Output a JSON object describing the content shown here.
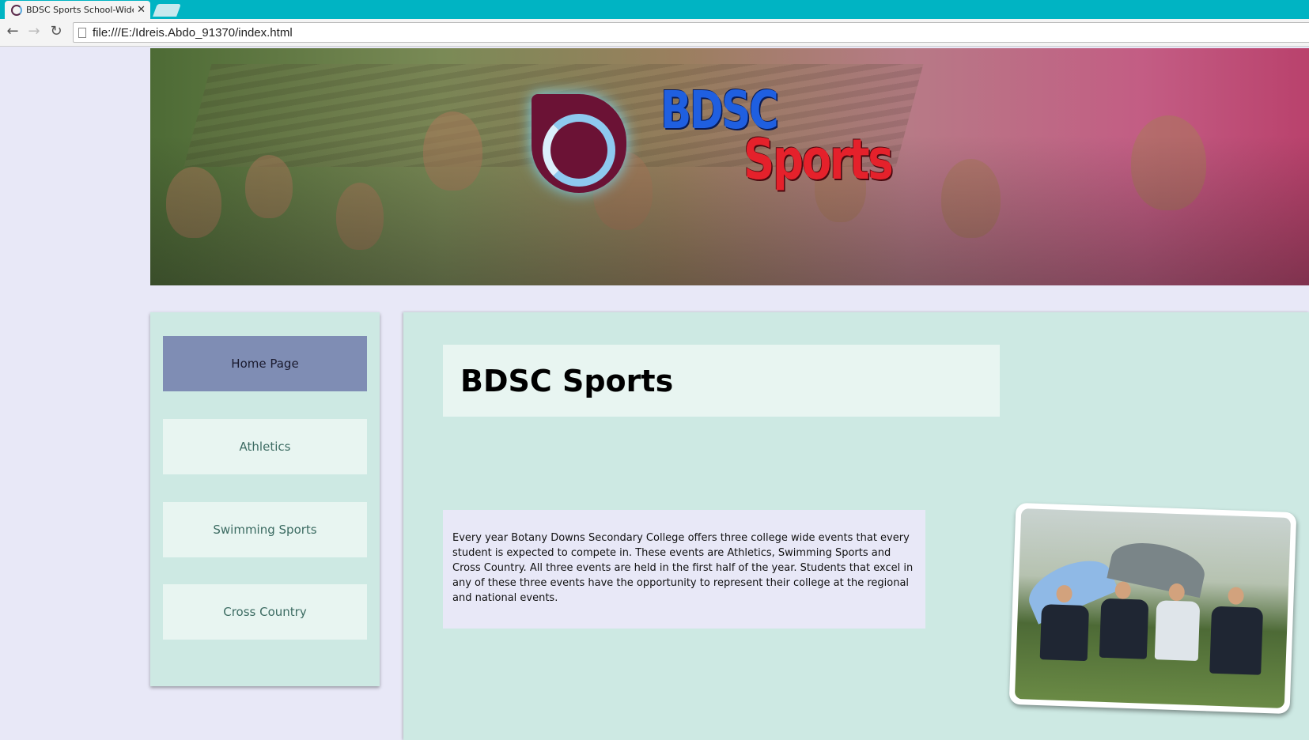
{
  "browser": {
    "tab_title": "BDSC Sports School-Wide",
    "tab_close": "✕",
    "url": "file:///E:/Idreis.Abdo_91370/index.html",
    "back_icon": "←",
    "forward_icon": "→",
    "reload_icon": "↻"
  },
  "banner": {
    "logo_line1": "BDSC",
    "logo_line2": "Sports"
  },
  "sidebar": {
    "items": [
      {
        "label": "Home Page",
        "active": true
      },
      {
        "label": "Athletics",
        "active": false
      },
      {
        "label": "Swimming Sports",
        "active": false
      },
      {
        "label": "Cross Country",
        "active": false
      }
    ]
  },
  "main": {
    "heading": "BDSC Sports",
    "intro": "Every year Botany Downs Secondary College offers three college wide events that every student is expected to compete in. These events are Athletics, Swimming Sports and Cross Country. All three events are held in the first half of the year. Students that excel in any of these three events have the opportunity to represent their college at the regional and national events."
  },
  "colors": {
    "chrome_teal": "#00b4c3",
    "page_bg": "#e8e8f7",
    "panel_bg": "#cde9e3",
    "nav_active": "#7f8db4",
    "nav_item": "#e8f5f1"
  }
}
